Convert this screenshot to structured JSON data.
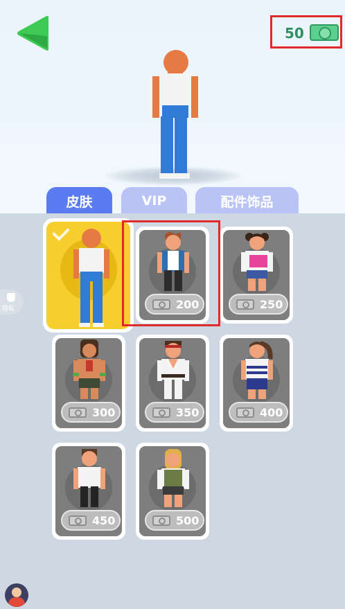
{
  "header": {
    "money": "50"
  },
  "tabs": [
    {
      "label": "皮肤",
      "active": true
    },
    {
      "label": "VIP",
      "active": false
    },
    {
      "label": "配件饰品",
      "active": false
    }
  ],
  "privacy_label": "隐私",
  "skins": [
    {
      "id": "current",
      "selected": true
    },
    {
      "price": "200",
      "highlighted": true
    },
    {
      "price": "250"
    },
    {
      "price": "300"
    },
    {
      "price": "350"
    },
    {
      "price": "400"
    },
    {
      "price": "450"
    },
    {
      "price": "500"
    }
  ],
  "colors": {
    "tab_active": "#5a7cf0",
    "tab_inactive": "#b9c3f5",
    "selected_card": "#f7ce2d",
    "highlight_box": "#e02a2a",
    "money_text": "#2f8f5e"
  }
}
